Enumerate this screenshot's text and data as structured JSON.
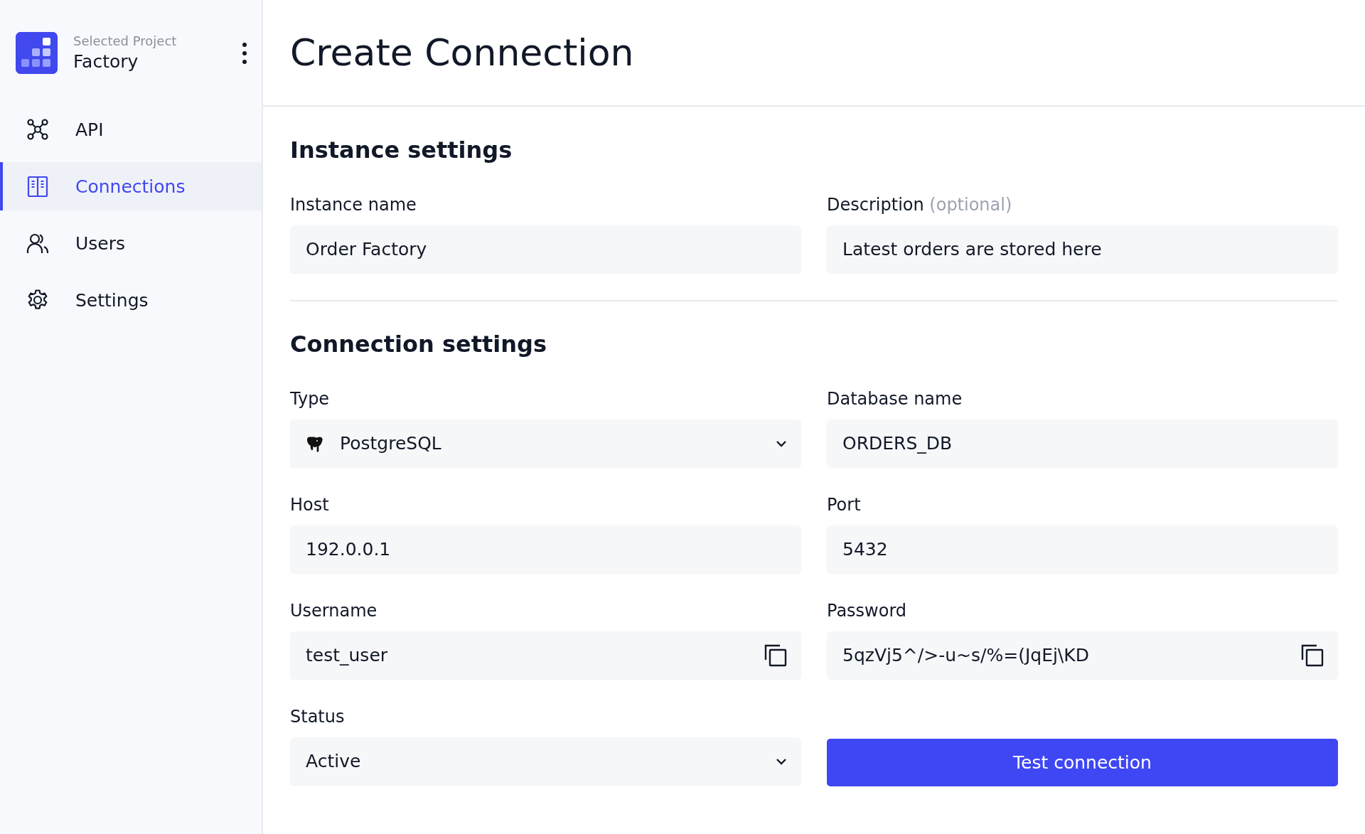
{
  "project": {
    "caption": "Selected Project",
    "name": "Factory"
  },
  "nav": [
    {
      "label": "API",
      "selected": false
    },
    {
      "label": "Connections",
      "selected": true
    },
    {
      "label": "Users",
      "selected": false
    },
    {
      "label": "Settings",
      "selected": false
    }
  ],
  "page_title": "Create Connection",
  "sections": [
    {
      "title": "Instance settings",
      "fields": [
        {
          "label": "Instance name",
          "kind": "text",
          "value": "Order Factory"
        },
        {
          "label": "Description",
          "hint": "(optional)",
          "kind": "text",
          "value": "Latest orders are stored here"
        }
      ]
    },
    {
      "title": "Connection settings",
      "fields": [
        {
          "label": "Type",
          "kind": "select",
          "value": "PostgreSQL"
        },
        {
          "label": "Database name",
          "kind": "text",
          "value": "ORDERS_DB"
        },
        {
          "label": "Host",
          "kind": "text",
          "value": "192.0.0.1"
        },
        {
          "label": "Port",
          "kind": "text",
          "value": "5432"
        },
        {
          "label": "Username",
          "kind": "copy",
          "value": "test_user"
        },
        {
          "label": "Password",
          "kind": "copy",
          "value": "5qzVj5^/>-u~s/%=(JqEj\\KD"
        },
        {
          "label": "Status",
          "kind": "select",
          "value": "Active"
        },
        {
          "kind": "button",
          "label": "Test connection"
        }
      ]
    }
  ]
}
